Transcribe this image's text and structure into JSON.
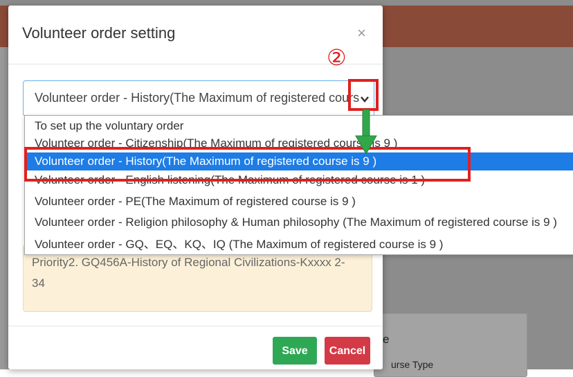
{
  "modal": {
    "title": "Volunteer order setting",
    "close": "×"
  },
  "select": {
    "value": "Volunteer order - History(The Maximum of registered cours"
  },
  "dropdown": {
    "items": [
      "To set up the voluntary order",
      "Volunteer order - Citizenship(The Maximum of registered course is 9 )",
      "Volunteer order - History(The Maximum of registered course is 9 )",
      "Volunteer order - English listening(The Maximum of registered course is 1 )",
      "Volunteer order - PE(The Maximum of registered course is 9 )",
      "Volunteer order - Religion philosophy & Human philosophy (The Maximum of registered course is 9 )",
      "Volunteer order - GQ、EQ、KQ、IQ (The Maximum of registered course is 9 )"
    ],
    "selected_index": 2
  },
  "priority": {
    "text": "Priority2. GQ456A-History of Regional Civilizations-Kxxxx 2-34"
  },
  "buttons": {
    "save": "Save",
    "cancel": "Cancel"
  },
  "annotation": {
    "step": "②",
    "color_red": "#e02020",
    "color_green": "#2fa84a"
  },
  "background": {
    "card_text1": "e",
    "card_text2": "urse Type"
  },
  "colors": {
    "header": "#8a4a38",
    "selected": "#1e7ce6",
    "save": "#2fa856",
    "cancel": "#d33a45"
  }
}
